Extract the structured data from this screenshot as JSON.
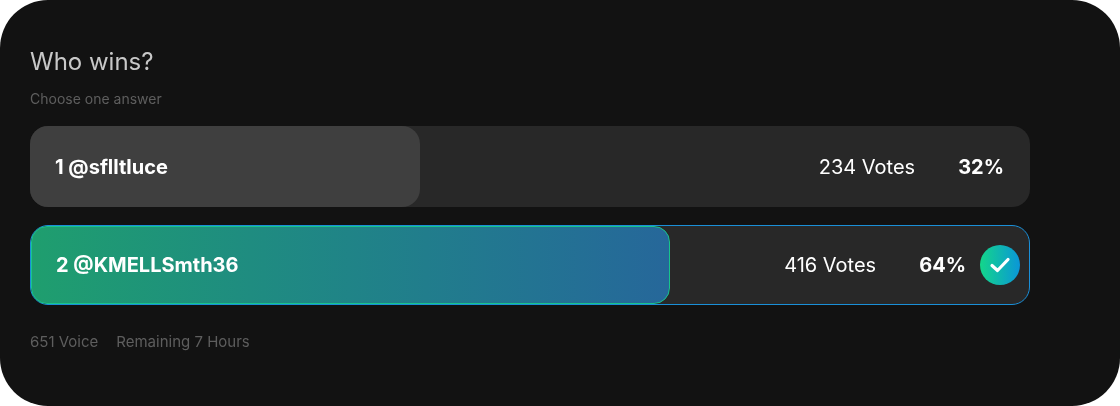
{
  "title": "Who wins?",
  "subtitle": "Choose one answer",
  "options": [
    {
      "label": "1 @sflltluce",
      "votes": "234 Votes",
      "percent": "32%",
      "level": 0.39,
      "selected": false
    },
    {
      "label": "2 @KMELLSmth36",
      "votes": "416 Votes",
      "percent": "64%",
      "level": 0.64,
      "selected": true
    }
  ],
  "footer": {
    "total": "651 Voice",
    "remaining": "Remaining 7 Hours"
  }
}
